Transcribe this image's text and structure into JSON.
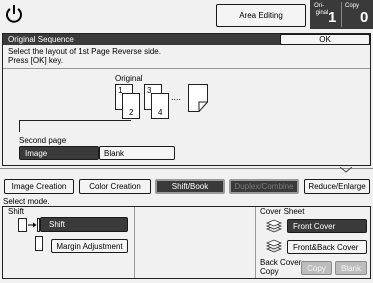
{
  "header": {
    "power_icon": "power-icon",
    "area_editing_label": "Area Editing",
    "originals_caption": "Ori-\n ginal",
    "originals_count": "1",
    "copies_caption": "Copy",
    "copies_count": "0"
  },
  "dialog": {
    "title": "Original Sequence",
    "ok_label": "OK",
    "instruction_line1": "Select the layout of 1st Page Reverse side.",
    "instruction_line2": "Press [OK] key.",
    "original_label": "Original",
    "page_numbers": [
      "1",
      "2",
      "3",
      "4"
    ],
    "ellipsis": "....",
    "second_page_label": "Second page",
    "options": [
      {
        "label": "Image",
        "selected": true
      },
      {
        "label": "Blank",
        "selected": false
      }
    ]
  },
  "tabs": [
    {
      "label": "Image Creation",
      "active": false,
      "disabled": false
    },
    {
      "label": "Color Creation",
      "active": false,
      "disabled": false
    },
    {
      "label": "Shift/Book",
      "active": true,
      "disabled": false
    },
    {
      "label": "Duplex/Combine",
      "active": false,
      "disabled": true
    },
    {
      "label": "Reduce/Enlarge",
      "active": false,
      "disabled": false
    }
  ],
  "panel": {
    "select_mode_label": "Select mode.",
    "shift": {
      "group_label": "Shift",
      "shift_button_label": "Shift",
      "margin_button_label": "Margin Adjustment",
      "arrow_glyph": "→"
    },
    "cover_sheet": {
      "group_label": "Cover Sheet",
      "front_cover_label": "Front Cover",
      "front_back_cover_label": "Front&Back Cover",
      "back_cover_copy_label": "Back Cover\nCopy",
      "copy_label": "Copy",
      "blank_label": "Blank"
    }
  },
  "colors": {
    "dark_fill": "#3a3a3a",
    "background": "#f1f1f1",
    "disabled_fill": "#bdbdbd"
  }
}
